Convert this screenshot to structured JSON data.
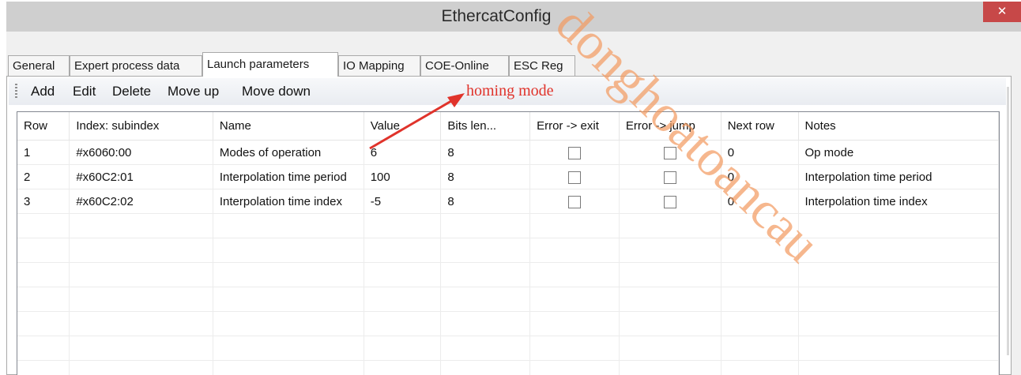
{
  "window": {
    "title": "EthercatConfig",
    "close_label": "✕"
  },
  "tabs": [
    {
      "label": "General",
      "active": false
    },
    {
      "label": "Expert process data",
      "active": false
    },
    {
      "label": "Launch parameters",
      "active": true
    },
    {
      "label": "IO Mapping",
      "active": false
    },
    {
      "label": "COE-Online",
      "active": false
    },
    {
      "label": "ESC Reg",
      "active": false
    }
  ],
  "toolbar": {
    "add_label": "Add",
    "edit_label": "Edit",
    "delete_label": "Delete",
    "move_up_label": "Move up",
    "move_down_label": "Move down"
  },
  "annotation": {
    "text": "homing mode",
    "color": "#e0332b"
  },
  "table": {
    "columns": [
      "Row",
      "Index: subindex",
      "Name",
      "Value",
      "Bits len...",
      "Error -> exit",
      "Error -> jump",
      "Next row",
      "Notes"
    ],
    "rows": [
      {
        "row": "1",
        "index": "#x6060:00",
        "name": "Modes of operation",
        "value": "6",
        "bits": "8",
        "error_exit": false,
        "error_jump": false,
        "next_row": "0",
        "notes": "Op mode"
      },
      {
        "row": "2",
        "index": "#x60C2:01",
        "name": "Interpolation time period",
        "value": "100",
        "bits": "8",
        "error_exit": false,
        "error_jump": false,
        "next_row": "0",
        "notes": "Interpolation time period"
      },
      {
        "row": "3",
        "index": "#x60C2:02",
        "name": "Interpolation time index",
        "value": "-5",
        "bits": "8",
        "error_exit": false,
        "error_jump": false,
        "next_row": "0",
        "notes": "Interpolation time index"
      }
    ]
  },
  "watermark": {
    "text": "donghoatoancau",
    "color": "#f39a5f"
  }
}
